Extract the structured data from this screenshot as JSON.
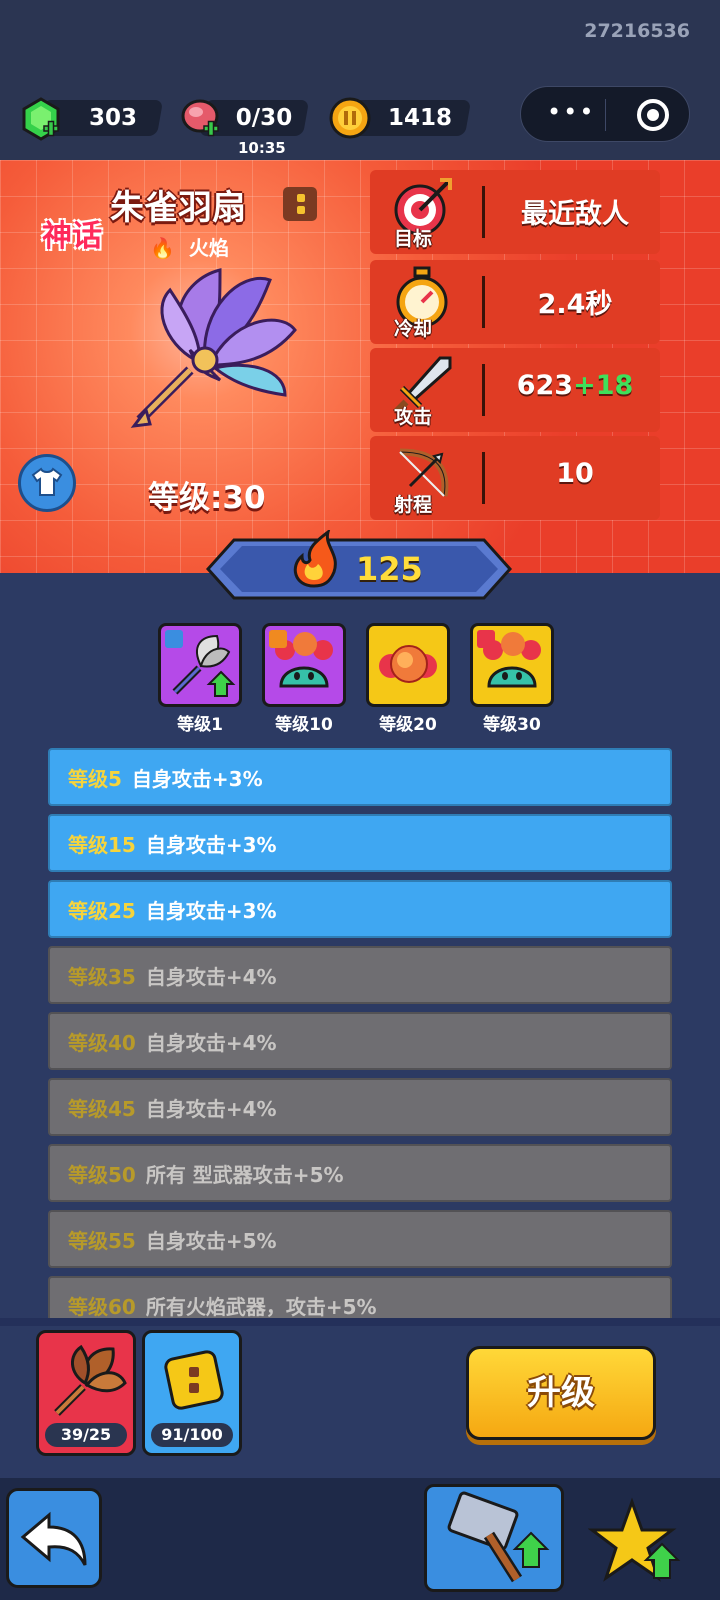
{
  "header": {
    "user_id": "27216536",
    "gems": "303",
    "energy": "0/30",
    "energy_timer": "10:35",
    "coins": "1418"
  },
  "weapon": {
    "rarity": "神话",
    "name": "朱雀羽扇",
    "element": "火焰",
    "level_label": "等级:30",
    "power": "125"
  },
  "stats": [
    {
      "label": "目标",
      "value": "最近敌人",
      "plus": ""
    },
    {
      "label": "冷却",
      "value": "2.4秒",
      "plus": ""
    },
    {
      "label": "攻击",
      "value": "623",
      "plus": "+18"
    },
    {
      "label": "射程",
      "value": "10",
      "plus": ""
    }
  ],
  "skills": [
    {
      "label": "等级1"
    },
    {
      "label": "等级10"
    },
    {
      "label": "等级20"
    },
    {
      "label": "等级30"
    }
  ],
  "bonuses": [
    {
      "level": "等级5",
      "text": "自身攻击+3%",
      "unlocked": true
    },
    {
      "level": "等级15",
      "text": "自身攻击+3%",
      "unlocked": true
    },
    {
      "level": "等级25",
      "text": "自身攻击+3%",
      "unlocked": true
    },
    {
      "level": "等级35",
      "text": "自身攻击+4%",
      "unlocked": false
    },
    {
      "level": "等级40",
      "text": "自身攻击+4%",
      "unlocked": false
    },
    {
      "level": "等级45",
      "text": "自身攻击+4%",
      "unlocked": false
    },
    {
      "level": "等级50",
      "text": "所有 型武器攻击+5%",
      "unlocked": false
    },
    {
      "level": "等级55",
      "text": "自身攻击+5%",
      "unlocked": false
    },
    {
      "level": "等级60",
      "text": "所有火焰武器，攻击+5%",
      "unlocked": false
    }
  ],
  "materials": [
    {
      "count": "39/25"
    },
    {
      "count": "91/100"
    }
  ],
  "actions": {
    "upgrade_label": "升级"
  },
  "colors": {
    "unlocked_row": "#3fa7f2",
    "locked_row": "#6f6e72",
    "level_text": "#f6d43c",
    "bonus_plus": "#3fe05a",
    "power_text": "#ffdd3b"
  }
}
